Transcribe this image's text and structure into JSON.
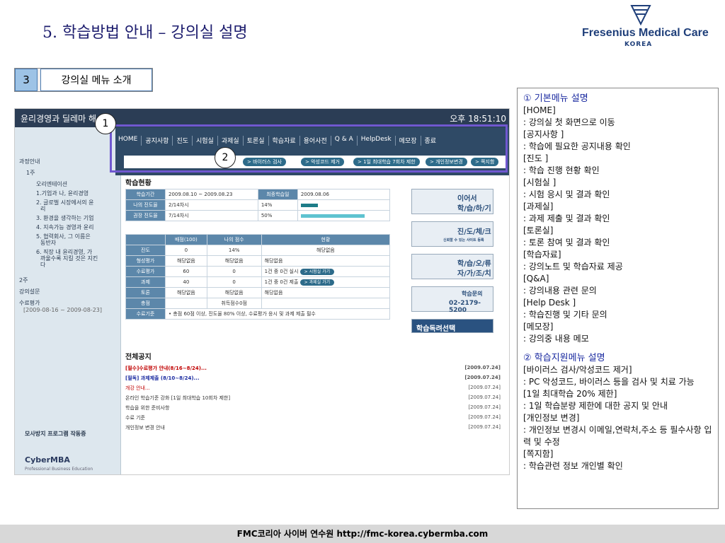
{
  "slide": {
    "title": "5. 학습방법 안내 – 강의실 설명",
    "logo_name": "Fresenius Medical Care",
    "logo_sub": "KOREA",
    "section_num": "3",
    "section_label": "강의실 메뉴 소개",
    "badge1": "1",
    "badge2": "2",
    "footer": "FMC코리아 사이버 연수원 http://fmc-korea.cybermba.com"
  },
  "shot": {
    "course_title": "윤리경영과 딜레마 해",
    "clock": "오후 18:51:10",
    "menu": [
      "HOME",
      "공지사항",
      "진도",
      "시험실",
      "과제실",
      "토론실",
      "학습자료",
      "용어사전",
      "Q & A",
      "HelpDesk",
      "메모장",
      "종료"
    ],
    "pills": [
      "> 바이러스 검사",
      "> 악성코드 제거",
      "> 1일 최대학습 7회차 제한",
      "> 개인정보변경",
      "> 쪽지함"
    ],
    "sidebar": [
      "과정안내",
      "1주",
      "오리엔테이션",
      "1.기업과 나, 윤리경영",
      "2. 글로벌 시장에서의 윤",
      "리",
      "3. 환경을 생각하는 기업",
      "4. 지속가능 경영과 윤리",
      "5. 협력회사, 그 이름은",
      "동반자",
      "6. 직장 내 윤리경영, 가",
      "까울수록 지킬 것은 지킨",
      "다",
      "2주",
      "강의설문",
      "수료평가",
      "[2009-08-16 ~ 2009-08-23]",
      "모사방지 프로그램 작동중",
      "CyberMBA",
      "Professional Business Education"
    ],
    "status_title": "학습현황",
    "info": [
      [
        "학습기간",
        "2009.08.10 ~ 2009.08.23",
        "최종학습일",
        "2009.08.06"
      ],
      [
        "나의 진도율",
        "2/14차시",
        "14%"
      ],
      [
        "권장 진도율",
        "7/14차시",
        "50%"
      ]
    ],
    "grade_headers": [
      "",
      "배점(100)",
      "나의 점수",
      "현황"
    ],
    "grades": [
      [
        "진도",
        "0",
        "14%",
        "해당없음"
      ],
      [
        "형성평가",
        "해당없음",
        "해당없음",
        "해당없음"
      ],
      [
        "수료평가",
        "60",
        "0",
        "1건 중 0건 실시"
      ],
      [
        "과제",
        "40",
        "0",
        "1건 중 0건 제출"
      ],
      [
        "토론",
        "해당없음",
        "해당없음",
        "해당없음"
      ],
      [
        "총점",
        "",
        "취득점수0점",
        ""
      ],
      [
        "수료기준",
        "• 총점 60점 이상, 진도율 80% 이상, 수료평가 응시 및 과제 제출 필수",
        "",
        ""
      ]
    ],
    "go_exam": "> 시험실 가기",
    "go_task": "> 과제실 가기",
    "side_buttons": [
      "이어서",
      "학/습/하/기",
      "진/도/체/크",
      "신뢰할 수 있는 사이트 등록",
      "학/습/오/류",
      "자/가/조/치",
      "학습문의",
      "02-2179-5200",
      "학습독려선택"
    ],
    "notice_title": "전체공지",
    "notices": [
      [
        "[필수]수료평가 안내(8/16~8/24)...",
        "[2009.07.24]"
      ],
      [
        "[필독] 과제제출 (8/10~8/24)...",
        "[2009.07.24]"
      ],
      [
        "개강 안내...",
        "[2009.07.24]"
      ],
      [
        "온라인 학습기준 강화 [1일 최대학습 10회차 제한]",
        "[2009.07.24]"
      ],
      [
        "학습을 위한 준비사항",
        "[2009.07.24]"
      ],
      [
        "수료 기준",
        "[2009.07.24]"
      ],
      [
        "개인정보 변경 안내",
        "[2009.07.24]"
      ]
    ]
  },
  "desc": {
    "h1": "① 기본메뉴 설명",
    "items1": [
      "[HOME]",
      ": 강의실 첫 화면으로 이동",
      "[공지사항 ]",
      ": 학습에 필요한 공지내용 확인",
      "[진도 ]",
      ": 학습 진행 현황 확인",
      "[시험실 ]",
      ": 시험 응시 및 결과 확인",
      "[과제실]",
      ": 과제 제출 및 결과 확인",
      "[토론실]",
      ": 토론 참여 및 결과 확인",
      "[학습자료]",
      ": 강의노트 및 학습자료 제공",
      "[Q&A]",
      ": 강의내용 관련 문의",
      "[Help Desk ]",
      ": 학습진행 및 기타 문의",
      "[메모장]",
      ": 강의중 내용 메모"
    ],
    "h2": "② 학습지원메뉴 설명",
    "items2": [
      "[바이러스 검사/악성코드 제거]",
      ": PC 악성코드, 바이러스 등을 검사 및 치료 가능",
      "[1일 최대학습 20% 제한]",
      ": 1일 학습분량 제한에 대한 공지 및 안내",
      "[개인정보 변경]",
      ": 개인정보 변경시 이메일,연락처,주소 등 필수사항 입력 및 수정",
      "[쪽지함]",
      ": 학습관련 정보 개인별 확인"
    ]
  },
  "colors": {
    "accent": "#7058d0",
    "title": "#1d1d6e",
    "nav": "#2f4a66"
  }
}
